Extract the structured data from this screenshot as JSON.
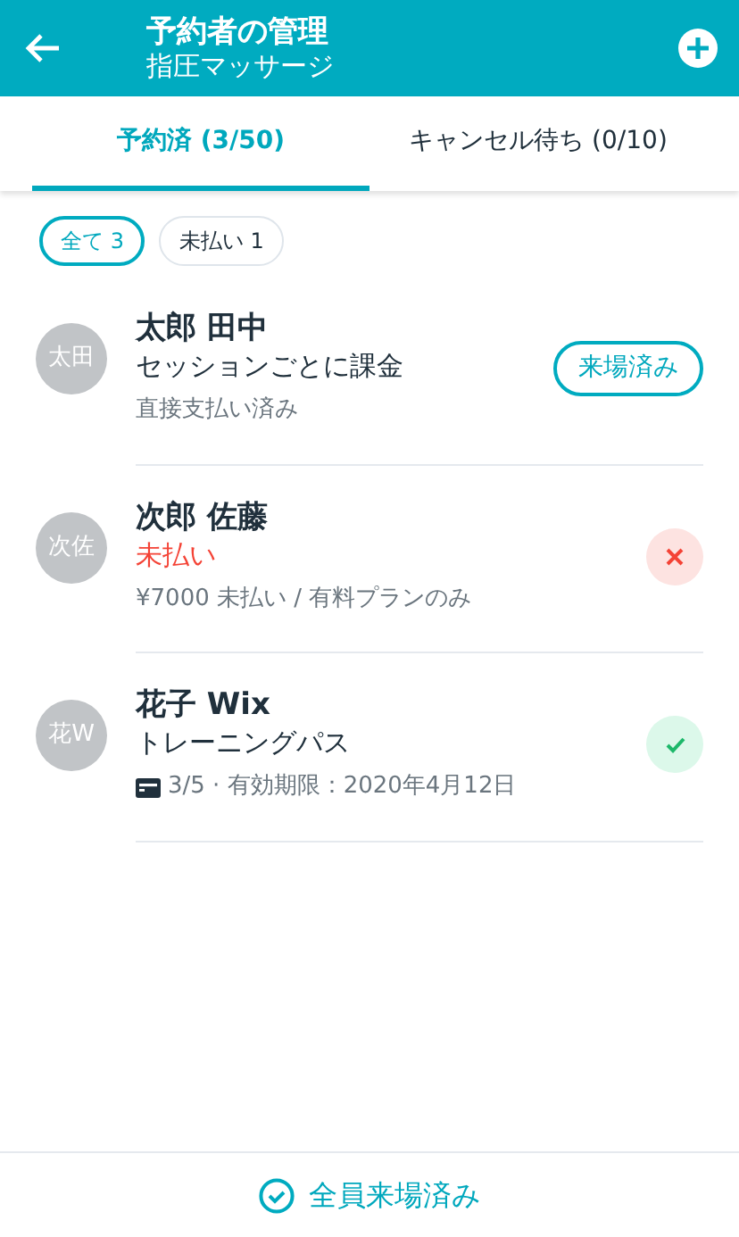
{
  "header": {
    "title": "予約者の管理",
    "subtitle": "指圧マッサージ"
  },
  "tabs": [
    {
      "label": "予約済 (3/50)",
      "selected": true
    },
    {
      "label": "キャンセル待ち (0/10)",
      "selected": false
    }
  ],
  "filters": [
    {
      "label": "全て",
      "count": "3",
      "selected": true
    },
    {
      "label": "未払い",
      "count": "1",
      "selected": false
    }
  ],
  "bookings": [
    {
      "initials": "太田",
      "name": "太郎 田中",
      "status": "セッションごとに課金",
      "status_alert": false,
      "detail": "直接支払い済み",
      "action": {
        "kind": "button",
        "label": "来場済み"
      }
    },
    {
      "initials": "次佐",
      "name": "次郎 佐藤",
      "status": "未払い",
      "status_alert": true,
      "detail": "¥7000 未払い / 有料プランのみ",
      "action": {
        "kind": "cancel"
      }
    },
    {
      "initials": "花W",
      "name": "花子 Wix",
      "status": "トレーニングパス",
      "status_alert": false,
      "detail": "3/5 · 有効期限：2020年4月12日",
      "card_icon": true,
      "action": {
        "kind": "check"
      }
    }
  ],
  "footer": {
    "label": "全員来場済み"
  }
}
